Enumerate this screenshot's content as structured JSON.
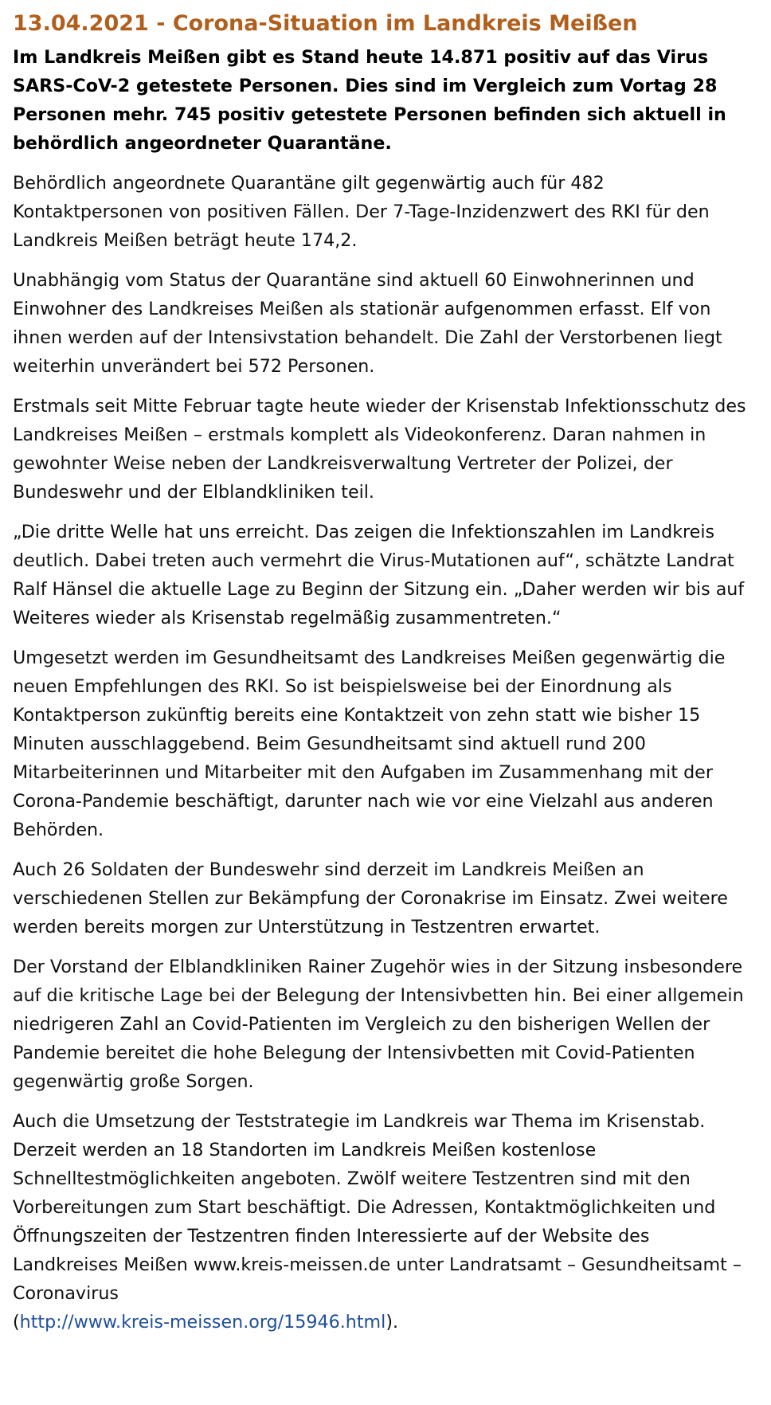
{
  "article": {
    "title": "13.04.2021 - Corona-Situation im Landkreis Meißen",
    "lead": "Im Landkreis Meißen gibt es Stand heute 14.871 positiv auf das Virus SARS-CoV-2 getestete Personen. Dies sind im Vergleich zum Vortag 28 Personen mehr. 745 positiv getestete Personen befinden sich aktuell in behördlich angeordneter Quarantäne.",
    "paragraphs": [
      "Behördlich angeordnete Quarantäne gilt gegenwärtig auch für 482 Kontaktpersonen von positiven Fällen. Der 7-Tage-Inzidenzwert des RKI für den Landkreis Meißen beträgt heute 174,2.",
      "Unabhängig vom Status der Quarantäne sind aktuell 60 Einwohnerinnen und Einwohner des Landkreises Meißen als stationär aufgenommen erfasst. Elf von ihnen werden auf der Intensivstation behandelt. Die Zahl der Verstorbenen liegt weiterhin unverändert bei 572 Personen.",
      "Erstmals seit Mitte Februar tagte heute wieder der Krisenstab Infektionsschutz des Landkreises Meißen – erstmals komplett als Videokonferenz. Daran nahmen in gewohnter Weise neben der Landkreisverwaltung Vertreter der Polizei, der Bundeswehr und der Elblandkliniken teil.",
      "„Die dritte Welle hat uns erreicht. Das zeigen die Infektionszahlen im Landkreis deutlich. Dabei treten auch vermehrt die Virus-Mutationen auf“, schätzte Landrat Ralf Hänsel die aktuelle Lage zu Beginn der Sitzung ein. „Daher werden wir bis auf Weiteres wieder als Krisenstab regelmäßig zusammentreten.“",
      "Umgesetzt werden im Gesundheitsamt des Landkreises Meißen gegenwärtig die neuen Empfehlungen des RKI. So ist beispielsweise bei der Einordnung als Kontaktperson zukünftig bereits eine Kontaktzeit von zehn statt wie bisher 15 Minuten ausschlaggebend. Beim Gesundheitsamt sind aktuell rund 200 Mitarbeiterinnen und Mitarbeiter mit den Aufgaben im Zusammenhang mit der Corona-Pandemie beschäftigt, darunter nach wie vor eine Vielzahl aus anderen Behörden.",
      "Auch 26 Soldaten der Bundeswehr sind derzeit im Landkreis Meißen an verschiedenen Stellen zur Bekämpfung der Coronakrise im Einsatz. Zwei weitere werden bereits morgen zur Unterstützung in Testzentren erwartet.",
      "Der Vorstand der Elblandkliniken Rainer Zugehör wies in der Sitzung insbesondere auf die kritische Lage bei der Belegung der Intensivbetten hin. Bei einer allgemein niedrigeren Zahl an Covid-Patienten im Vergleich zu den bisherigen Wellen der Pandemie bereitet die hohe Belegung der Intensivbetten mit Covid-Patienten gegenwärtig große Sorgen."
    ],
    "last_paragraph": {
      "text": "Auch die Umsetzung der Teststrategie im Landkreis war Thema im Krisenstab. Derzeit werden an 18 Standorten im Landkreis Meißen kostenlose Schnelltestmöglichkeiten angeboten. Zwölf weitere Testzentren sind mit den Vorbereitungen zum Start beschäftigt. Die Adressen, Kontaktmöglichkeiten und Öffnungszeiten der Testzentren finden Interessierte auf der Website des Landkreises Meißen www.kreis-meissen.de unter Landratsamt – Gesundheitsamt – Coronavirus",
      "open_paren": "(",
      "link_text": "http://www.kreis-meissen.org/15946.html",
      "close_text": ")."
    }
  },
  "colors": {
    "title": "#b05f1d",
    "link": "#1f4f9a",
    "text": "#111111"
  }
}
